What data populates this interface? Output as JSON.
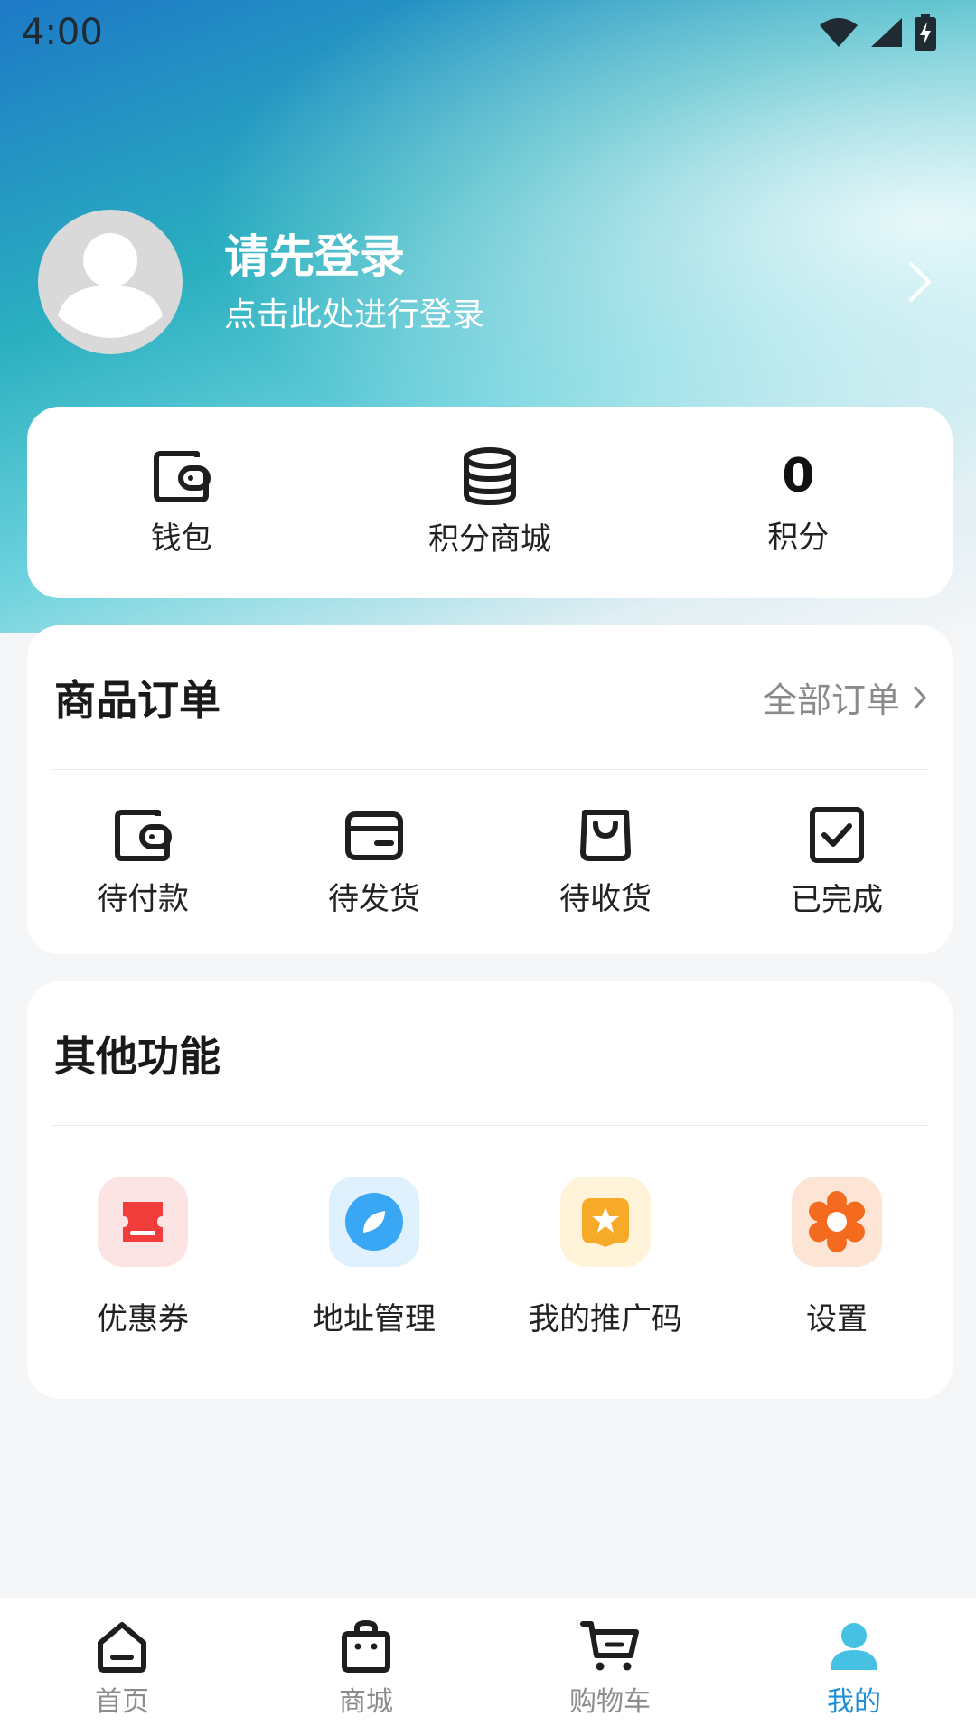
{
  "status_bar": {
    "time": "4:00",
    "icons": [
      "wifi-icon",
      "signal-icon",
      "battery-charging-icon"
    ]
  },
  "profile": {
    "title": "请先登录",
    "subtitle": "点击此处进行登录",
    "avatar_icon": "default-avatar-icon",
    "chevron_icon": "chevron-right-icon"
  },
  "stats": {
    "wallet_label": "钱包",
    "wallet_icon": "wallet-icon",
    "points_mall_label": "积分商城",
    "points_mall_icon": "database-stack-icon",
    "points_value": "0",
    "points_label": "积分"
  },
  "orders": {
    "title": "商品订单",
    "all_orders_label": "全部订单",
    "items": [
      {
        "label": "待付款",
        "icon": "wallet-icon"
      },
      {
        "label": "待发货",
        "icon": "card-box-icon"
      },
      {
        "label": "待收货",
        "icon": "shopping-bag-icon"
      },
      {
        "label": "已完成",
        "icon": "checkbox-icon"
      }
    ]
  },
  "others": {
    "title": "其他功能",
    "items": [
      {
        "label": "优惠券",
        "icon": "coupon-icon",
        "color": "#f23d3d",
        "bg": "#fde4e4"
      },
      {
        "label": "地址管理",
        "icon": "compass-icon",
        "color": "#3aa7f5",
        "bg": "#dff1fd"
      },
      {
        "label": "我的推广码",
        "icon": "star-badge-icon",
        "color": "#f7a928",
        "bg": "#fff3d9"
      },
      {
        "label": "设置",
        "icon": "gear-icon",
        "color": "#f46b1f",
        "bg": "#fde5d6"
      }
    ]
  },
  "tabbar": {
    "items": [
      {
        "label": "首页",
        "icon": "home-icon"
      },
      {
        "label": "商城",
        "icon": "shop-bag-icon"
      },
      {
        "label": "购物车",
        "icon": "cart-icon"
      },
      {
        "label": "我的",
        "icon": "user-icon"
      }
    ],
    "active_index": 3,
    "active_color": "#1f8fd6"
  }
}
